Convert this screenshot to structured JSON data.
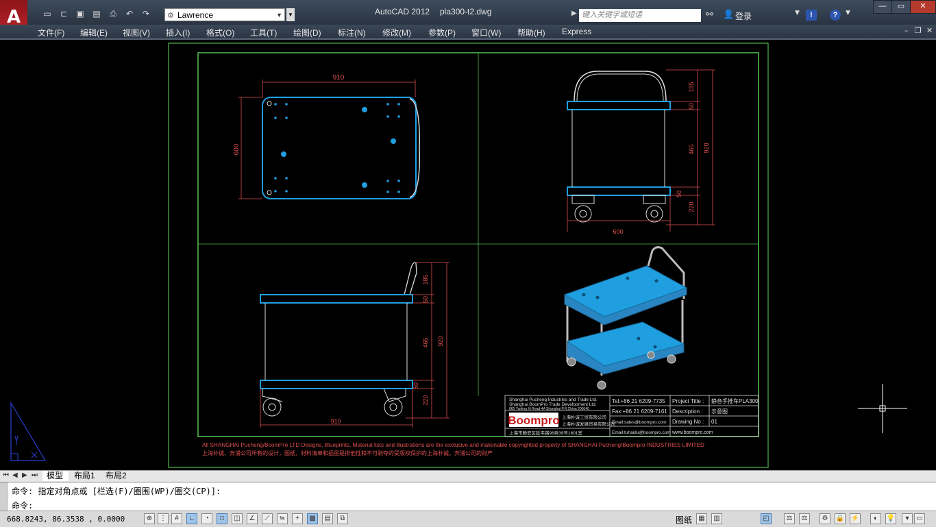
{
  "titlebar": {
    "app_title": "AutoCAD 2012",
    "file_name": "pla300-t2.dwg",
    "app_logo": "A",
    "workspace": "Lawrence",
    "search_placeholder": "键入关键字或短语",
    "login_label": "登录"
  },
  "quick_access": [
    "new-icon",
    "open-icon",
    "save-icon",
    "save-as-icon",
    "print-icon",
    "undo-icon",
    "redo-icon"
  ],
  "menu": {
    "items": [
      "文件(F)",
      "编辑(E)",
      "视图(V)",
      "插入(I)",
      "格式(O)",
      "工具(T)",
      "绘图(D)",
      "标注(N)",
      "修改(M)",
      "参数(P)",
      "窗口(W)",
      "帮助(H)",
      "Express"
    ]
  },
  "drawing": {
    "dimensions": {
      "top_width": "910",
      "top_depth": "600",
      "side_h1": "185",
      "side_h2": "50",
      "side_h3": "465",
      "side_total": "920",
      "side_h4": "50",
      "side_h5": "220",
      "side_width": "600",
      "front_h1": "185",
      "front_h2": "50",
      "front_h3": "465",
      "front_total": "920",
      "front_h4": "50",
      "front_h5": "220",
      "front_width": "910"
    },
    "title_block": {
      "company_en1": "Shanghai Pucheng Industries and Trade Ltd.",
      "company_en2": "Shanghai BoomPro Trade Development Ltd.",
      "address_en": "865 Yanling Xi Road-4A Shanghai P.R.China 200040",
      "brand": "Boompro",
      "company_cn1": "上海朴诚工贸有限公司",
      "company_cn2": "上海朴诚发展贸易有限公司",
      "address_cn": "上海市静安区延平路98弄39号1601室",
      "tel": "Tel:+86 21 6209-7735",
      "fax": "Fax:+86 21 6209-7161",
      "email": "Email:sales@boompro.com",
      "email2": "Email:tuhaidu@boompro.com",
      "project_label": "Project  Title :",
      "project_value": "静音手推车PLA300",
      "desc_label": "Description :",
      "desc_value": "示意图",
      "drawing_no_label": "Drawing  No :",
      "drawing_no_value": "01",
      "website": "www.boompro.com"
    },
    "copyright_en": "All SHANGHAI Pucheng/BoomPro  LTD Designs, Blueprints, Material lists and illustrations are the exclusive and inalienable copyrighted property of SHANGHAI Pucheng/Boompro INDUSTRIES LIMITED",
    "copyright_cn": "上海朴诚、奔浦公司所有的设计，图纸，材料清单和插图是排他性和不可剥夺的受版权保护的上海朴诚，奔浦公司的财产"
  },
  "tabs": {
    "items": [
      "模型",
      "布局1",
      "布局2"
    ],
    "active": "模型"
  },
  "command": {
    "line1": "命令: 指定对角点或 [栏选(F)/圈围(WP)/圈交(CP)]:",
    "line2": "命令:"
  },
  "status": {
    "coords": "668.8243, 86.3538 , 0.0000",
    "model_label": "图纸"
  },
  "colors": {
    "frame_green": "#4fb84f",
    "dim_red": "#e05050",
    "part_blue": "#1f9fe0",
    "ucs_blue": "#2a3fd0"
  }
}
